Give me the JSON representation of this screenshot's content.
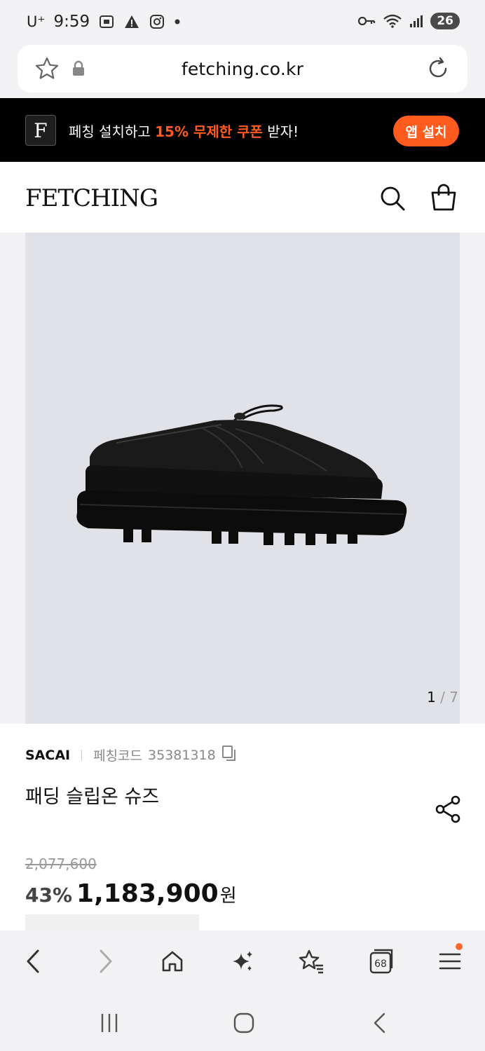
{
  "status": {
    "carrier": "U⁺",
    "time": "9:59",
    "battery": "26"
  },
  "browser": {
    "url": "fetching.co.kr"
  },
  "banner": {
    "logo_letter": "F",
    "text_before": "페칭 설치하고 ",
    "text_highlight": "15% 무제한 쿠폰",
    "text_after": " 받자!",
    "install_label": "앱 설치"
  },
  "header": {
    "logo": "FETCHING"
  },
  "gallery": {
    "current": "1",
    "separator": " / ",
    "total": "7"
  },
  "product": {
    "brand": "SACAI",
    "code_label": "페칭코드",
    "code": "35381318",
    "title": "패딩 슬립온 슈즈",
    "original_price": "2,077,600",
    "discount": "43%",
    "sale_price": "1,183,900",
    "currency": "원"
  },
  "toolbar": {
    "tabs_count": "68"
  },
  "colors": {
    "accent": "#ff5b1f",
    "banner_bg": "#000000",
    "image_bg": "#e0e2e7"
  },
  "icons": [
    "star-icon",
    "lock-icon",
    "reload-icon",
    "search-icon",
    "bag-icon",
    "copy-icon",
    "share-icon",
    "back-icon",
    "forward-icon",
    "home-icon",
    "sparkle-icon",
    "bookmarks-icon",
    "tabs-icon",
    "menu-icon",
    "recents-icon",
    "home-circle-icon",
    "nav-back-icon"
  ]
}
